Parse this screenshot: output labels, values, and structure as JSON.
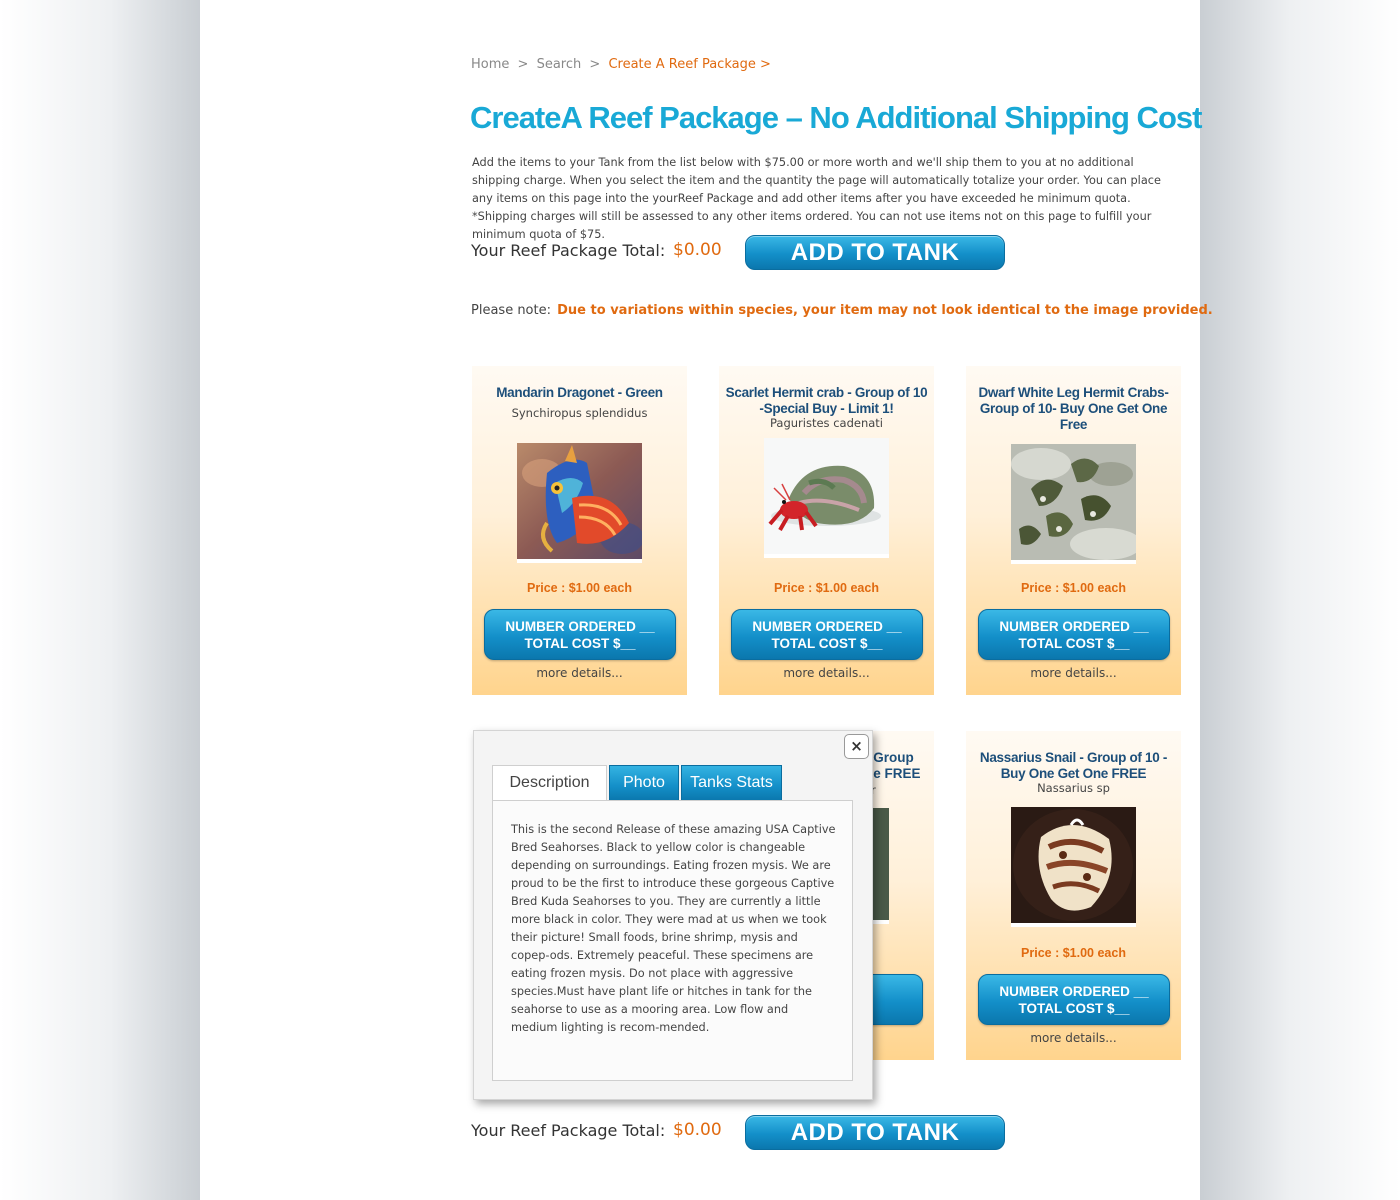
{
  "breadcrumb": {
    "home": "Home",
    "sep1": ">",
    "search": "Search",
    "sep2": ">",
    "current": "Create A Reef Package >"
  },
  "page_title": "CreateA Reef Package – No Additional Shipping Cost",
  "intro": "Add the items to your Tank from the list below with $75.00 or more worth and we'll ship them to you at no additional shipping charge. When you select the item and the quantity the page will automatically totalize your order.   You can place any items on this page into the yourReef Package and add other items after you have exceeded he minimum quota. *Shipping charges will still be assessed to any other items ordered. You can not use items not on this page to fulfill your minimum quota of $75.",
  "total": {
    "label": "Your Reef Package Total:",
    "value": "$0.00",
    "button": "ADD TO TANK"
  },
  "note": {
    "prefix": "Please note:",
    "warning": "Due to variations within species, your item may not look identical to the image provided."
  },
  "product_common": {
    "order_line1": "NUMBER ORDERED __",
    "order_line2": "TOTAL COST  $__",
    "more": "more details..."
  },
  "products": [
    {
      "title": "Mandarin Dragonet - Green",
      "sci": "Synchiropus splendidus",
      "price": "Price : $1.00  each",
      "image": "mandarin-dragonet-photo"
    },
    {
      "title": "Scarlet Hermit crab - Group of 10 -Special Buy - Limit 1!",
      "sci": "Paguristes cadenati",
      "price": "Price : $1.00  each",
      "image": "scarlet-hermit-crab-photo"
    },
    {
      "title": "Dwarf White Leg Hermit Crabs- Group of 10- Buy One Get One Free",
      "sci": "",
      "price": "Price : $1.00  each",
      "image": "white-leg-hermit-crabs-photo"
    },
    {
      "title_partial": "- Group\nne FREE",
      "sci_partial": "r"
    },
    {
      "title": "Nassarius Snail - Group of 10 - Buy One Get One FREE",
      "sci": "Nassarius sp",
      "price": "Price : $1.00  each",
      "image": "nassarius-snail-photo"
    }
  ],
  "popup": {
    "close": "×",
    "tabs": [
      "Description",
      "Photo",
      "Tanks Stats"
    ],
    "description": "This is the second Release of these amazing USA Captive Bred Seahorses. Black to yellow color is changeable depending on surroundings. Eating frozen mysis. We are proud to be the first to introduce these gorgeous Captive Bred Kuda Seahorses to you. They are currently a little more black in color. They were mad at us when we took their picture! Small foods, brine shrimp, mysis and copep-ods. Extremely peaceful. These specimens are eating frozen mysis. Do not place with aggressive species.Must have plant life or hitches in tank for the seahorse to use as a mooring area. Low flow and medium lighting is recom-mended."
  },
  "colors": {
    "accent_blue": "#19a9d6",
    "accent_orange": "#e06a10",
    "title_navy": "#1d4f7a"
  }
}
